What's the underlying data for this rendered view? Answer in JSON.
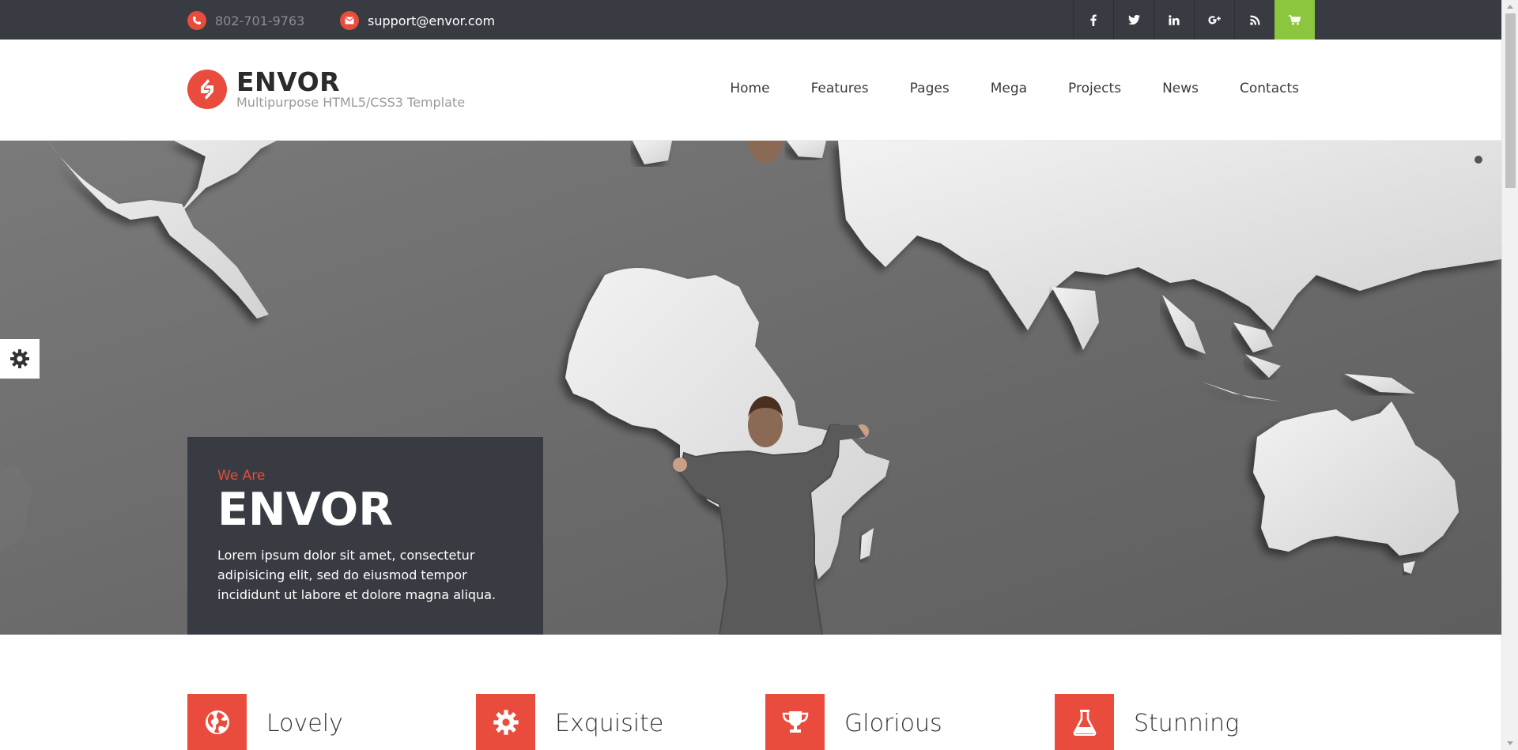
{
  "topbar": {
    "phone": "802-701-9763",
    "email": "support@envor.com",
    "social": [
      {
        "name": "facebook-icon",
        "glyph": "f"
      },
      {
        "name": "twitter-icon",
        "glyph": "t"
      },
      {
        "name": "linkedin-icon",
        "glyph": "in"
      },
      {
        "name": "google-plus-icon",
        "glyph": "g+"
      },
      {
        "name": "rss-icon",
        "glyph": "rss"
      },
      {
        "name": "cart-icon",
        "glyph": "cart"
      }
    ]
  },
  "brand": {
    "title": "ENVOR",
    "tagline": "Multipurpose HTML5/CSS3 Template"
  },
  "nav": {
    "items": [
      "Home",
      "Features",
      "Pages",
      "Mega",
      "Projects",
      "News",
      "Contacts"
    ]
  },
  "hero": {
    "pretitle": "We Are",
    "title": "ENVOR",
    "text": "Lorem ipsum dolor sit amet, consectetur adipisicing elit, sed do eiusmod tempor incididunt ut labore et dolore magna aliqua."
  },
  "features": [
    {
      "label": "Lovely",
      "icon": "globe-icon"
    },
    {
      "label": "Exquisite",
      "icon": "gear-icon"
    },
    {
      "label": "Glorious",
      "icon": "trophy-icon"
    },
    {
      "label": "Stunning",
      "icon": "flask-icon"
    }
  ],
  "colors": {
    "accent": "#e94b3c",
    "dark": "#383c42",
    "cart": "#8cc63f"
  }
}
